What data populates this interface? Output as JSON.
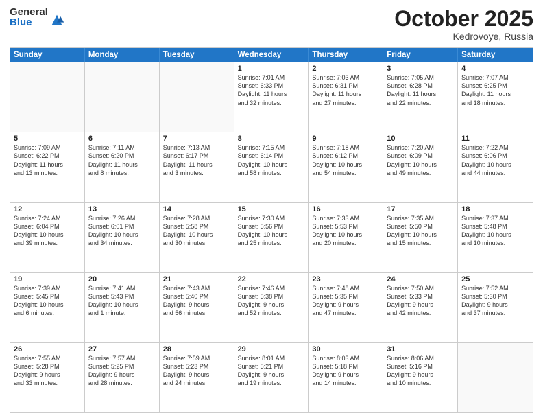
{
  "logo": {
    "general": "General",
    "blue": "Blue"
  },
  "header": {
    "month": "October 2025",
    "location": "Kedrovoye, Russia"
  },
  "weekdays": [
    "Sunday",
    "Monday",
    "Tuesday",
    "Wednesday",
    "Thursday",
    "Friday",
    "Saturday"
  ],
  "weeks": [
    [
      {
        "day": "",
        "lines": []
      },
      {
        "day": "",
        "lines": []
      },
      {
        "day": "",
        "lines": []
      },
      {
        "day": "1",
        "lines": [
          "Sunrise: 7:01 AM",
          "Sunset: 6:33 PM",
          "Daylight: 11 hours",
          "and 32 minutes."
        ]
      },
      {
        "day": "2",
        "lines": [
          "Sunrise: 7:03 AM",
          "Sunset: 6:31 PM",
          "Daylight: 11 hours",
          "and 27 minutes."
        ]
      },
      {
        "day": "3",
        "lines": [
          "Sunrise: 7:05 AM",
          "Sunset: 6:28 PM",
          "Daylight: 11 hours",
          "and 22 minutes."
        ]
      },
      {
        "day": "4",
        "lines": [
          "Sunrise: 7:07 AM",
          "Sunset: 6:25 PM",
          "Daylight: 11 hours",
          "and 18 minutes."
        ]
      }
    ],
    [
      {
        "day": "5",
        "lines": [
          "Sunrise: 7:09 AM",
          "Sunset: 6:22 PM",
          "Daylight: 11 hours",
          "and 13 minutes."
        ]
      },
      {
        "day": "6",
        "lines": [
          "Sunrise: 7:11 AM",
          "Sunset: 6:20 PM",
          "Daylight: 11 hours",
          "and 8 minutes."
        ]
      },
      {
        "day": "7",
        "lines": [
          "Sunrise: 7:13 AM",
          "Sunset: 6:17 PM",
          "Daylight: 11 hours",
          "and 3 minutes."
        ]
      },
      {
        "day": "8",
        "lines": [
          "Sunrise: 7:15 AM",
          "Sunset: 6:14 PM",
          "Daylight: 10 hours",
          "and 58 minutes."
        ]
      },
      {
        "day": "9",
        "lines": [
          "Sunrise: 7:18 AM",
          "Sunset: 6:12 PM",
          "Daylight: 10 hours",
          "and 54 minutes."
        ]
      },
      {
        "day": "10",
        "lines": [
          "Sunrise: 7:20 AM",
          "Sunset: 6:09 PM",
          "Daylight: 10 hours",
          "and 49 minutes."
        ]
      },
      {
        "day": "11",
        "lines": [
          "Sunrise: 7:22 AM",
          "Sunset: 6:06 PM",
          "Daylight: 10 hours",
          "and 44 minutes."
        ]
      }
    ],
    [
      {
        "day": "12",
        "lines": [
          "Sunrise: 7:24 AM",
          "Sunset: 6:04 PM",
          "Daylight: 10 hours",
          "and 39 minutes."
        ]
      },
      {
        "day": "13",
        "lines": [
          "Sunrise: 7:26 AM",
          "Sunset: 6:01 PM",
          "Daylight: 10 hours",
          "and 34 minutes."
        ]
      },
      {
        "day": "14",
        "lines": [
          "Sunrise: 7:28 AM",
          "Sunset: 5:58 PM",
          "Daylight: 10 hours",
          "and 30 minutes."
        ]
      },
      {
        "day": "15",
        "lines": [
          "Sunrise: 7:30 AM",
          "Sunset: 5:56 PM",
          "Daylight: 10 hours",
          "and 25 minutes."
        ]
      },
      {
        "day": "16",
        "lines": [
          "Sunrise: 7:33 AM",
          "Sunset: 5:53 PM",
          "Daylight: 10 hours",
          "and 20 minutes."
        ]
      },
      {
        "day": "17",
        "lines": [
          "Sunrise: 7:35 AM",
          "Sunset: 5:50 PM",
          "Daylight: 10 hours",
          "and 15 minutes."
        ]
      },
      {
        "day": "18",
        "lines": [
          "Sunrise: 7:37 AM",
          "Sunset: 5:48 PM",
          "Daylight: 10 hours",
          "and 10 minutes."
        ]
      }
    ],
    [
      {
        "day": "19",
        "lines": [
          "Sunrise: 7:39 AM",
          "Sunset: 5:45 PM",
          "Daylight: 10 hours",
          "and 6 minutes."
        ]
      },
      {
        "day": "20",
        "lines": [
          "Sunrise: 7:41 AM",
          "Sunset: 5:43 PM",
          "Daylight: 10 hours",
          "and 1 minute."
        ]
      },
      {
        "day": "21",
        "lines": [
          "Sunrise: 7:43 AM",
          "Sunset: 5:40 PM",
          "Daylight: 9 hours",
          "and 56 minutes."
        ]
      },
      {
        "day": "22",
        "lines": [
          "Sunrise: 7:46 AM",
          "Sunset: 5:38 PM",
          "Daylight: 9 hours",
          "and 52 minutes."
        ]
      },
      {
        "day": "23",
        "lines": [
          "Sunrise: 7:48 AM",
          "Sunset: 5:35 PM",
          "Daylight: 9 hours",
          "and 47 minutes."
        ]
      },
      {
        "day": "24",
        "lines": [
          "Sunrise: 7:50 AM",
          "Sunset: 5:33 PM",
          "Daylight: 9 hours",
          "and 42 minutes."
        ]
      },
      {
        "day": "25",
        "lines": [
          "Sunrise: 7:52 AM",
          "Sunset: 5:30 PM",
          "Daylight: 9 hours",
          "and 37 minutes."
        ]
      }
    ],
    [
      {
        "day": "26",
        "lines": [
          "Sunrise: 7:55 AM",
          "Sunset: 5:28 PM",
          "Daylight: 9 hours",
          "and 33 minutes."
        ]
      },
      {
        "day": "27",
        "lines": [
          "Sunrise: 7:57 AM",
          "Sunset: 5:25 PM",
          "Daylight: 9 hours",
          "and 28 minutes."
        ]
      },
      {
        "day": "28",
        "lines": [
          "Sunrise: 7:59 AM",
          "Sunset: 5:23 PM",
          "Daylight: 9 hours",
          "and 24 minutes."
        ]
      },
      {
        "day": "29",
        "lines": [
          "Sunrise: 8:01 AM",
          "Sunset: 5:21 PM",
          "Daylight: 9 hours",
          "and 19 minutes."
        ]
      },
      {
        "day": "30",
        "lines": [
          "Sunrise: 8:03 AM",
          "Sunset: 5:18 PM",
          "Daylight: 9 hours",
          "and 14 minutes."
        ]
      },
      {
        "day": "31",
        "lines": [
          "Sunrise: 8:06 AM",
          "Sunset: 5:16 PM",
          "Daylight: 9 hours",
          "and 10 minutes."
        ]
      },
      {
        "day": "",
        "lines": []
      }
    ]
  ]
}
